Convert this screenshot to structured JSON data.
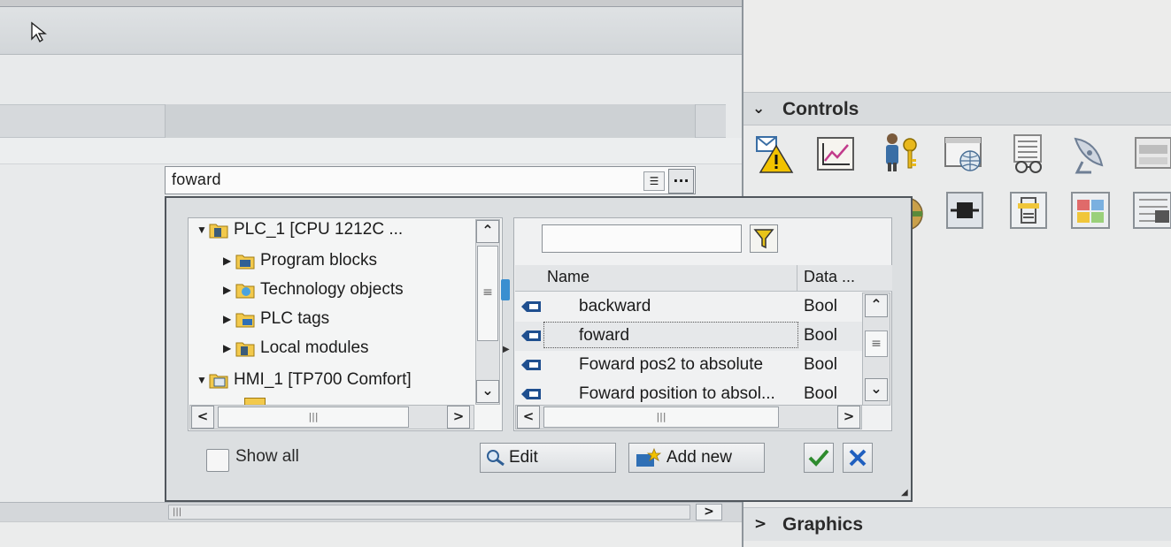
{
  "combo": {
    "value": "foward"
  },
  "tree": {
    "items": [
      {
        "label": "PLC_1 [CPU 1212C ...",
        "expanded": true,
        "level": 0
      },
      {
        "label": "Program blocks",
        "expanded": false,
        "level": 1
      },
      {
        "label": "Technology objects",
        "expanded": false,
        "level": 1
      },
      {
        "label": "PLC tags",
        "expanded": false,
        "level": 1
      },
      {
        "label": "Local modules",
        "expanded": false,
        "level": 1
      },
      {
        "label": "HMI_1 [TP700 Comfort]",
        "expanded": true,
        "level": 0
      }
    ]
  },
  "tags": {
    "filter_value": "",
    "columns": {
      "name": "Name",
      "type": "Data ..."
    },
    "rows": [
      {
        "name": "backward",
        "type": "Bool",
        "selected": false
      },
      {
        "name": "foward",
        "type": "Bool",
        "selected": true
      },
      {
        "name": "Foward pos2 to absolute",
        "type": "Bool",
        "selected": false
      },
      {
        "name": "Foward position to absol...",
        "type": "Bool",
        "selected": false
      }
    ]
  },
  "footer": {
    "show_all_label": "Show all",
    "show_all_checked": false,
    "edit_label": "Edit",
    "add_new_label": "Add new"
  },
  "task_card": {
    "controls_title": "Controls",
    "graphics_title": "Graphics"
  },
  "colors": {
    "accent": "#3a8fd0",
    "confirm": "#2e8b2e",
    "cancel": "#1f5fbf",
    "filter": "#e8c41a"
  }
}
